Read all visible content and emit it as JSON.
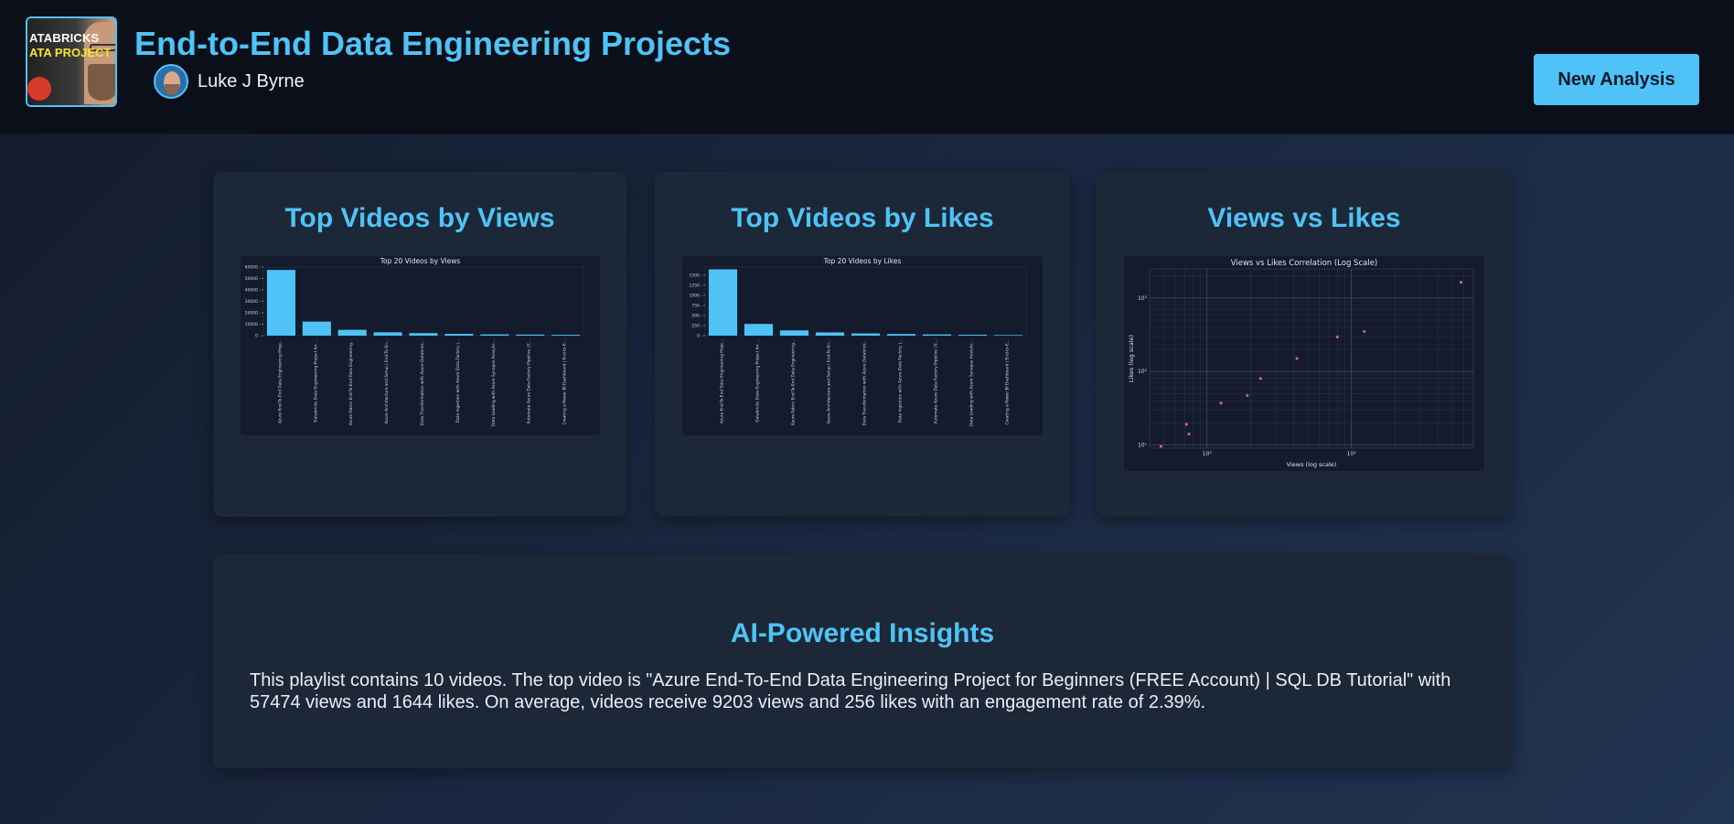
{
  "header": {
    "title": "End-to-End Data Engineering Projects",
    "author": "Luke J Byrne",
    "thumbnail_text": [
      "ATABRICKS",
      "ATA PROJECT"
    ],
    "new_analysis_label": "New Analysis"
  },
  "cards": {
    "views": {
      "title": "Top Videos by Views"
    },
    "likes": {
      "title": "Top Videos by Likes"
    },
    "scatter": {
      "title": "Views vs Likes"
    }
  },
  "insights": {
    "title": "AI-Powered Insights",
    "text": "This playlist contains 10 videos. The top video is \"Azure End-To-End Data Engineering Project for Beginners (FREE Account) | SQL DB Tutorial\" with 57474 views and 1644 likes. On average, videos receive 9203 views and 256 likes with an engagement rate of 2.39%."
  },
  "colors": {
    "accent": "#4fc3f7",
    "bar": "#4fc3f7",
    "point": "#e57373"
  },
  "chart_data": [
    {
      "type": "bar",
      "title": "Top 20 Videos by Views",
      "categories": [
        "Azure End-To-End Data Engineering Proje...",
        "Databricks Data Engineering Project for ...",
        "Azure Fabric End-To-End Data Engineering...",
        "Azure Architecture and Setup | End-To-En...",
        "Data Transformation with Azure Databrick...",
        "Data Ingestion with Azure Data Factory |...",
        "Data Loading with Azure Synapse Analytic...",
        "Automate Azure Data Factory Pipeline | E...",
        "Creating a Power BI Dashboard | End-to-E..."
      ],
      "values": [
        57474,
        12300,
        5100,
        2900,
        2200,
        1500,
        1100,
        900,
        700
      ],
      "yticks": [
        "0",
        "10000",
        "20000",
        "30000",
        "40000",
        "50000",
        "60000"
      ],
      "ylim": [
        0,
        60000
      ]
    },
    {
      "type": "bar",
      "title": "Top 20 Videos by Likes",
      "categories": [
        "Azure End-To-End Data Engineering Proje...",
        "Databricks Data Engineering Project for ...",
        "Azure Fabric End-To-End Data Engineering...",
        "Azure Architecture and Setup | End-To-En...",
        "Data Transformation with Azure Databrick...",
        "Data Ingestion with Azure Data Factory |...",
        "Automate Azure Data Factory Pipeline | E...",
        "Data Loading with Azure Synapse Analytic...",
        "Creating a Power BI Dashboard | End-to-E..."
      ],
      "values": [
        1644,
        290,
        130,
        80,
        55,
        40,
        30,
        22,
        15
      ],
      "yticks": [
        "0",
        "250",
        "500",
        "750",
        "1000",
        "1250",
        "1500"
      ],
      "ylim": [
        0,
        1700
      ]
    },
    {
      "type": "scatter",
      "title": "Views vs Likes Correlation (Log Scale)",
      "xlabel": "Views (log scale)",
      "ylabel": "Likes (log scale)",
      "log_scale": true,
      "xticks": [
        "10³",
        "10⁴"
      ],
      "yticks": [
        "10¹",
        "10²",
        "10³"
      ],
      "xlim": [
        400,
        70000
      ],
      "ylim": [
        9,
        2500
      ],
      "grid": true,
      "x": [
        480,
        720,
        750,
        1250,
        1900,
        2350,
        4200,
        8000,
        12300,
        57474
      ],
      "y": [
        9.5,
        19,
        14,
        37,
        47,
        80,
        150,
        295,
        350,
        1644
      ]
    }
  ]
}
